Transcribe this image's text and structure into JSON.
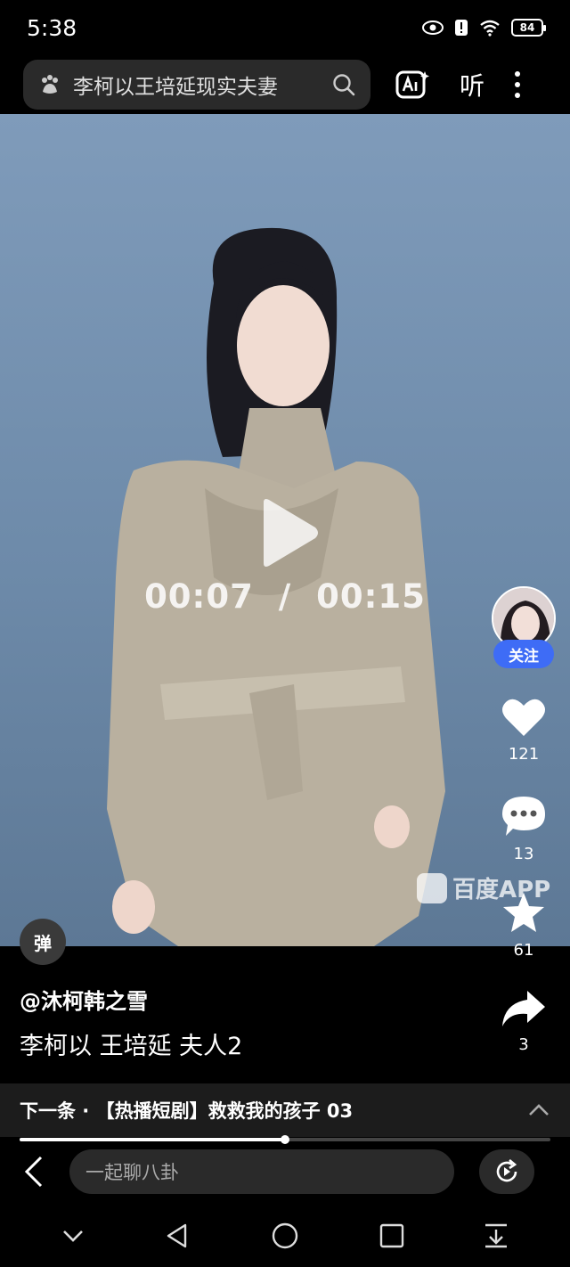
{
  "status_bar": {
    "time": "5:38",
    "battery": "84"
  },
  "top_bar": {
    "search_query": "李柯以王培延现实夫妻",
    "listen_label": "听"
  },
  "player": {
    "current_time": "00:07",
    "separator": "/",
    "duration": "00:15",
    "watermark": "百度APP",
    "danmu_label": "弹",
    "progress_fraction": 0.5
  },
  "rail": {
    "follow_label": "关注",
    "likes": "121",
    "comments": "13",
    "favorites": "61",
    "shares": "3"
  },
  "post": {
    "author": "@沐柯韩之雪",
    "caption": "李柯以 王培延 夫人2"
  },
  "next_up": {
    "text": "下一条 · 【热播短剧】救救我的孩子 03"
  },
  "comment": {
    "placeholder": "一起聊八卦"
  },
  "colors": {
    "accent": "#3e6cf6",
    "background": "#000000",
    "video_bg": "#7f9bba"
  }
}
